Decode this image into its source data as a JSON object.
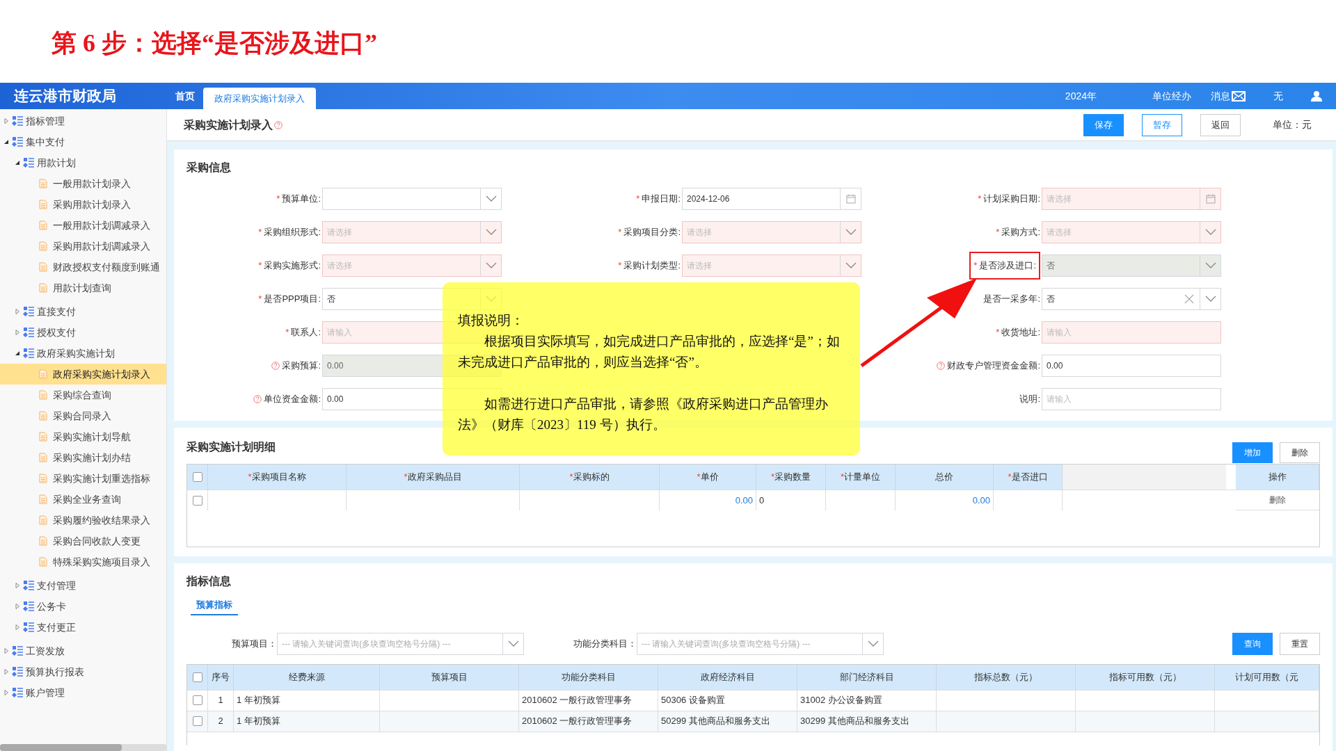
{
  "step_title": "第 6 步：选择“是否涉及进口”",
  "app": {
    "title": "连云港市财政局",
    "tabs": [
      {
        "label": "首页",
        "selected": false
      },
      {
        "label": "政府采购实施计划录入",
        "selected": true
      }
    ],
    "year": "2024年",
    "role": "单位经办",
    "messages": "消息",
    "user": "无"
  },
  "sidebar": {
    "items": [
      {
        "label": "指标管理",
        "kind": "group",
        "expanded": false,
        "selected": false
      },
      {
        "label": "集中支付",
        "kind": "group",
        "expanded": true,
        "selected": false,
        "children": [
          {
            "label": "用款计划",
            "kind": "group",
            "expanded": true,
            "selected": false,
            "children": [
              {
                "label": "一般用款计划录入",
                "kind": "page",
                "selected": false
              },
              {
                "label": "采购用款计划录入",
                "kind": "page",
                "selected": false
              },
              {
                "label": "一般用款计划调减录入",
                "kind": "page",
                "selected": false
              },
              {
                "label": "采购用款计划调减录入",
                "kind": "page",
                "selected": false
              },
              {
                "label": "财政授权支付额度到账通",
                "kind": "page",
                "selected": false
              },
              {
                "label": "用款计划查询",
                "kind": "page",
                "selected": false
              }
            ]
          },
          {
            "label": "直接支付",
            "kind": "group",
            "expanded": false,
            "selected": false
          },
          {
            "label": "授权支付",
            "kind": "group",
            "expanded": false,
            "selected": false
          },
          {
            "label": "政府采购实施计划",
            "kind": "group",
            "expanded": true,
            "selected": false,
            "children": [
              {
                "label": "政府采购实施计划录入",
                "kind": "page",
                "selected": true
              },
              {
                "label": "采购综合查询",
                "kind": "page",
                "selected": false
              },
              {
                "label": "采购合同录入",
                "kind": "page",
                "selected": false
              },
              {
                "label": "采购实施计划导航",
                "kind": "page",
                "selected": false
              },
              {
                "label": "采购实施计划办结",
                "kind": "page",
                "selected": false
              },
              {
                "label": "采购实施计划重选指标",
                "kind": "page",
                "selected": false
              },
              {
                "label": "采购全业务查询",
                "kind": "page",
                "selected": false
              },
              {
                "label": "采购履约验收结果录入",
                "kind": "page",
                "selected": false
              },
              {
                "label": "采购合同收款人变更",
                "kind": "page",
                "selected": false
              },
              {
                "label": "特殊采购实施项目录入",
                "kind": "page",
                "selected": false
              }
            ]
          },
          {
            "label": "支付管理",
            "kind": "group",
            "expanded": false,
            "selected": false
          },
          {
            "label": "公务卡",
            "kind": "group",
            "expanded": false,
            "selected": false
          },
          {
            "label": "支付更正",
            "kind": "group",
            "expanded": false,
            "selected": false
          }
        ]
      },
      {
        "label": "工资发放",
        "kind": "group",
        "expanded": false,
        "selected": false
      },
      {
        "label": "预算执行报表",
        "kind": "group",
        "expanded": false,
        "selected": false
      },
      {
        "label": "账户管理",
        "kind": "group",
        "expanded": false,
        "selected": false
      }
    ]
  },
  "page": {
    "title": "采购实施计划录入",
    "buttons": [
      {
        "label": "保存",
        "kind": "primary"
      },
      {
        "label": "暂存",
        "kind": "outline"
      },
      {
        "label": "返回",
        "kind": "plain"
      }
    ],
    "unit": "单位：元"
  },
  "form": {
    "title": "采购信息",
    "columns": [
      [
        {
          "label": "预算单位:",
          "star": "*",
          "kind": "select",
          "invalid": false,
          "disabled": false
        },
        {
          "label": "采购组织形式:",
          "star": "*",
          "kind": "select",
          "placeholder": "请选择",
          "invalid": true,
          "disabled": false
        },
        {
          "label": "采购实施形式:",
          "star": "*",
          "kind": "select",
          "placeholder": "请选择",
          "invalid": true,
          "disabled": false
        },
        {
          "label": "是否PPP项目:",
          "star": "*",
          "kind": "select",
          "value": "否",
          "invalid": false,
          "disabled": false
        },
        {
          "label": "联系人:",
          "star": "*",
          "kind": "input",
          "placeholder": "请输入",
          "invalid": true,
          "disabled": false
        },
        {
          "label": "采购预算:",
          "help": true,
          "kind": "input",
          "value": "0.00",
          "invalid": false,
          "disabled": true
        },
        {
          "label": "单位资金金额:",
          "help": true,
          "kind": "input",
          "value": "0.00",
          "invalid": false,
          "disabled": false
        }
      ],
      [
        {
          "label": "申报日期:",
          "star": "*",
          "kind": "date",
          "value": "2024-12-06",
          "invalid": false,
          "disabled": false
        },
        {
          "label": "采购项目分类:",
          "star": "*",
          "kind": "select",
          "placeholder": "请选择",
          "invalid": true,
          "disabled": false
        },
        {
          "label": "采购计划类型:",
          "star": "*",
          "kind": "select",
          "placeholder": "请选择",
          "invalid": true,
          "disabled": false
        }
      ],
      [
        {
          "label": "计划采购日期:",
          "star": "*",
          "kind": "date",
          "placeholder": "请选择",
          "invalid": true,
          "disabled": false
        },
        {
          "label": "采购方式:",
          "star": "*",
          "kind": "select",
          "placeholder": "请选择",
          "invalid": true,
          "disabled": false
        },
        {
          "label": "是否涉及进口:",
          "star": "*",
          "kind": "select",
          "value": "否",
          "invalid": false,
          "disabled": true,
          "highlighted": true
        },
        {
          "label": "是否一采多年:",
          "kind": "select",
          "value": "否",
          "clearable": true,
          "invalid": false,
          "disabled": false
        },
        {
          "label": "收货地址:",
          "star": "*",
          "kind": "input",
          "placeholder": "请输入",
          "invalid": true,
          "disabled": false
        },
        {
          "label": "财政专户管理资金金额:",
          "help": true,
          "kind": "input",
          "value": "0.00",
          "invalid": false,
          "disabled": false
        },
        {
          "label": "说明:",
          "kind": "input",
          "placeholder": "请输入",
          "invalid": false,
          "disabled": false
        }
      ]
    ]
  },
  "note": {
    "title": "填报说明：",
    "paragraphs": [
      "根据项目实际填写，如完成进口产品审批的，应选择“是”；如未完成进口产品审批的，则应当选择“否”。",
      "如需进行进口产品审批，请参照《政府采购进口产品管理办法》（财库〔2023〕119 号）执行。"
    ]
  },
  "detail": {
    "title": "采购实施计划明细",
    "buttons": [
      {
        "label": "增加",
        "kind": "primary"
      },
      {
        "label": "删除",
        "kind": "plain"
      }
    ],
    "columns": [
      {
        "label": "采购项目名称",
        "star": "*"
      },
      {
        "label": "政府采购品目",
        "star": "*"
      },
      {
        "label": "采购标的",
        "star": "*"
      },
      {
        "label": "单价",
        "star": "*"
      },
      {
        "label": "采购数量",
        "star": "*"
      },
      {
        "label": "计量单位",
        "star": "*"
      },
      {
        "label": "总价"
      },
      {
        "label": "是否进口",
        "star": "*"
      },
      {
        "label": "操作"
      }
    ],
    "all_checked": false,
    "rows": [
      {
        "checked": false,
        "cells": [
          "",
          "",
          "",
          "0.00",
          "0",
          "",
          "0.00",
          ""
        ],
        "action": "删除"
      }
    ]
  },
  "indicators": {
    "title": "指标信息",
    "tabs": [
      {
        "label": "预算指标",
        "selected": true
      }
    ],
    "filters": [
      {
        "label": "预算项目：",
        "placeholder": "--- 请输入关键词查询(多块查询空格号分隔) ---"
      },
      {
        "label": "功能分类科目：",
        "placeholder": "--- 请输入关键词查询(多块查询空格号分隔) ---"
      }
    ],
    "buttons": [
      {
        "label": "查询",
        "kind": "primary"
      },
      {
        "label": "重置",
        "kind": "plain"
      }
    ],
    "all_checked": false,
    "columns": [
      "序号",
      "经费来源",
      "预算项目",
      "功能分类科目",
      "政府经济科目",
      "部门经济科目",
      "指标总数（元）",
      "指标可用数（元）",
      "计划可用数（元"
    ],
    "rows": [
      {
        "checked": false,
        "cells": [
          "1",
          "1 年初预算",
          "",
          "2010602 一般行政管理事务",
          "50306 设备购置",
          "31002 办公设备购置",
          "",
          "",
          ""
        ]
      },
      {
        "checked": false,
        "cells": [
          "2",
          "1 年初预算",
          "",
          "2010602 一般行政管理事务",
          "50299 其他商品和服务支出",
          "30299 其他商品和服务支出",
          "",
          "",
          ""
        ]
      }
    ]
  }
}
